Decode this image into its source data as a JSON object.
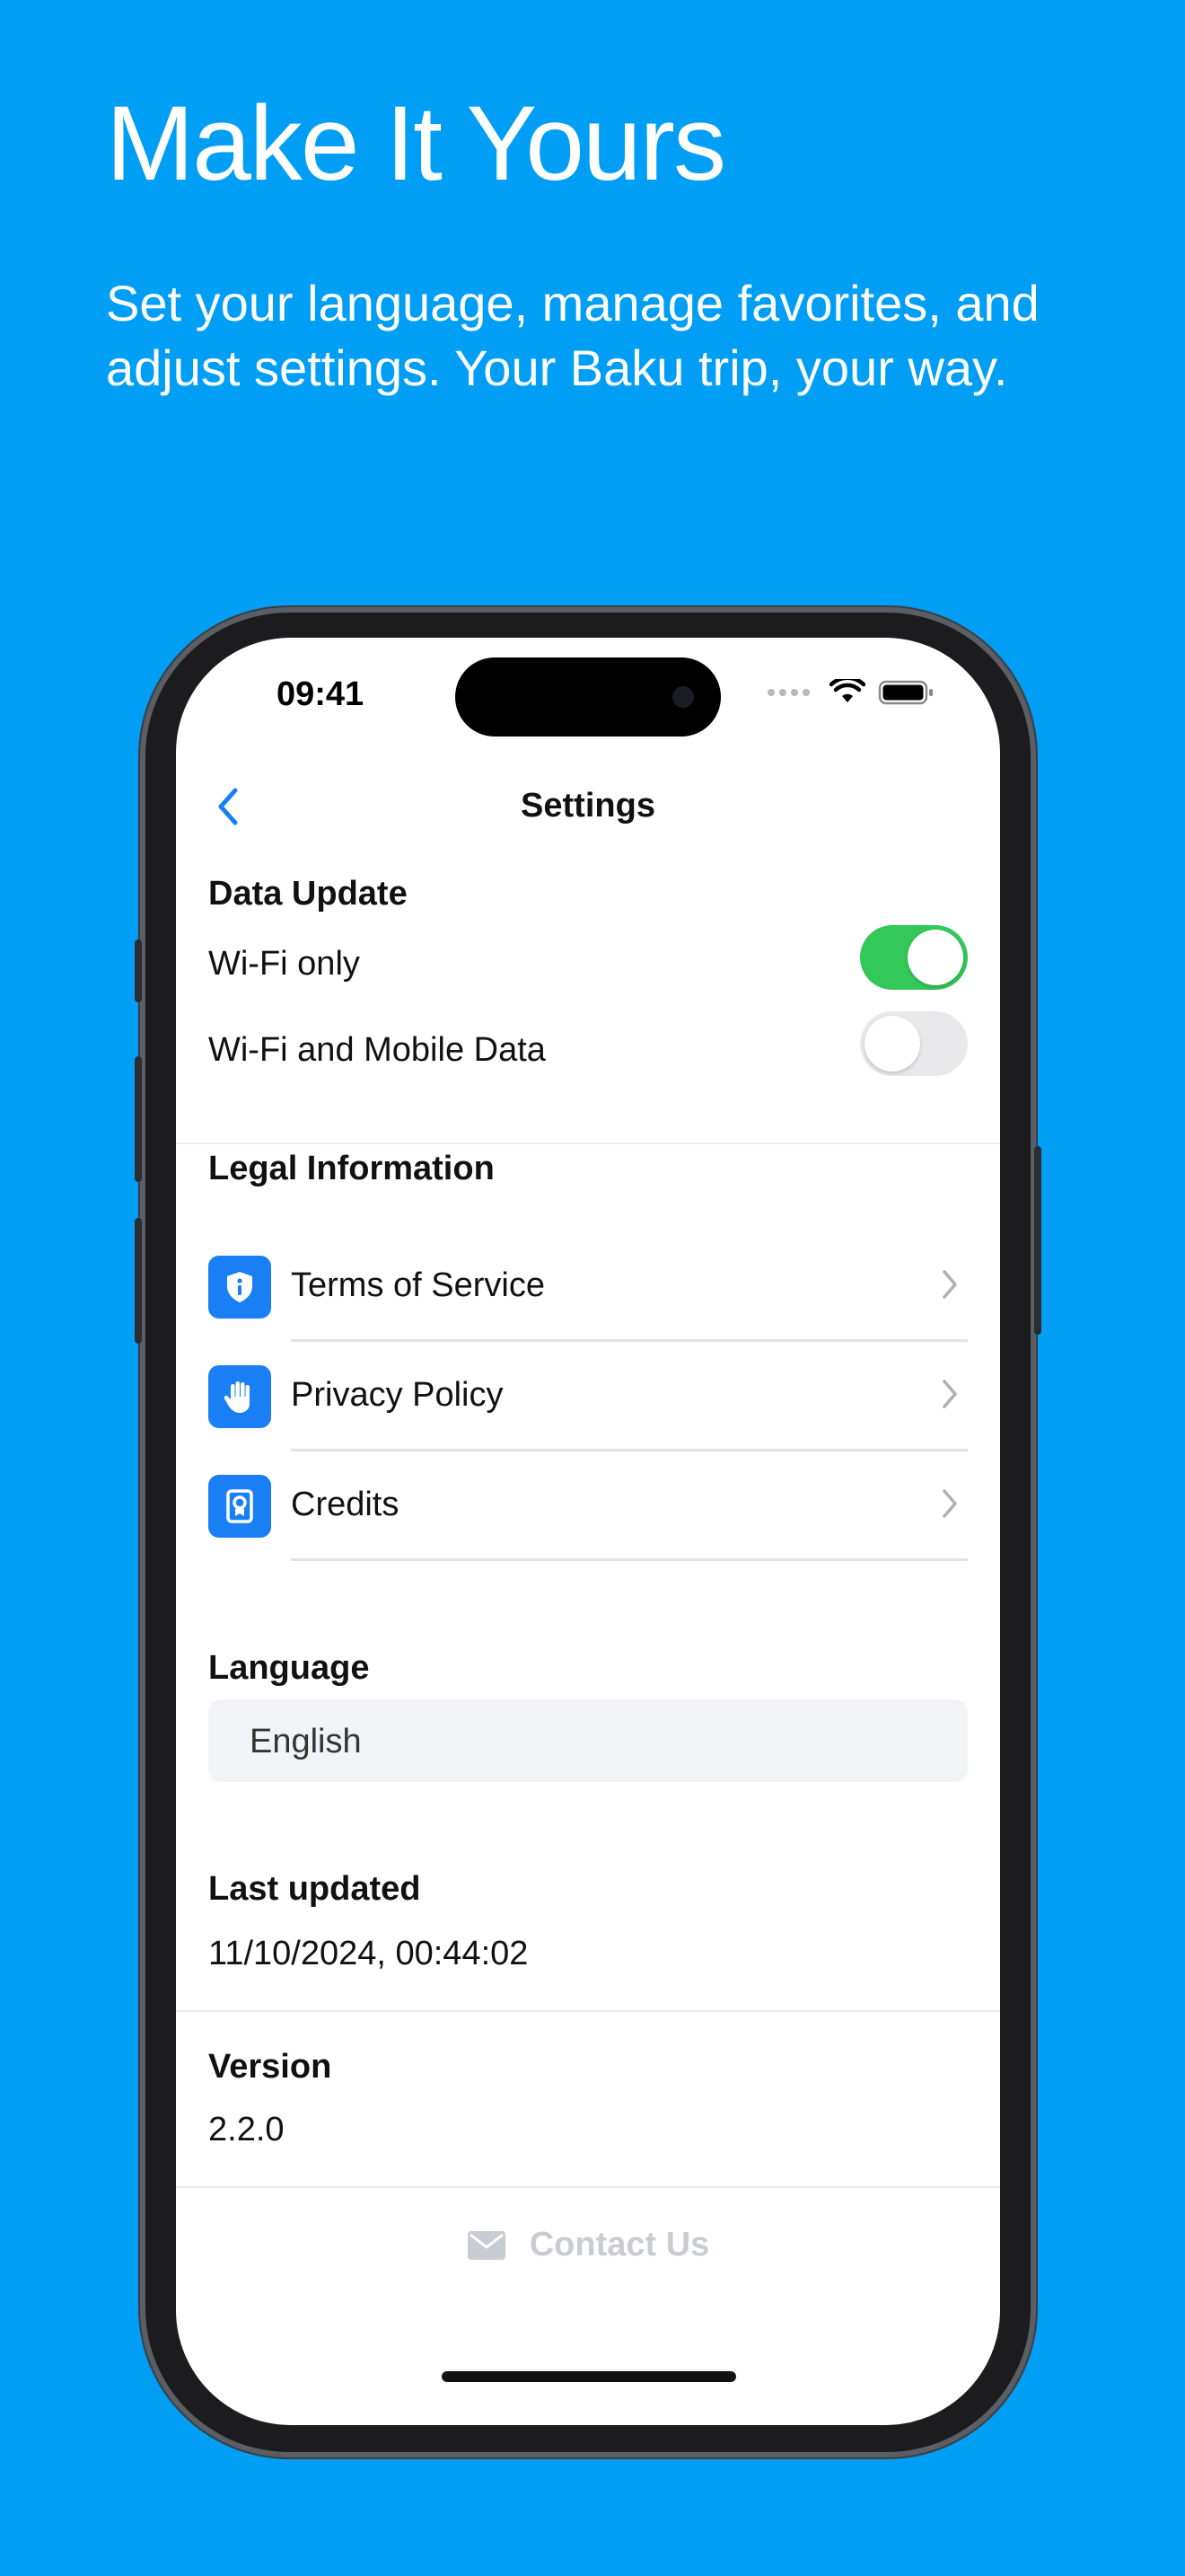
{
  "hero": {
    "title": "Make It Yours",
    "subtitle_line1": "Set your language, manage favorites, and",
    "subtitle_line2": "adjust settings. Your Baku trip, your way."
  },
  "status_bar": {
    "time": "09:41"
  },
  "nav": {
    "title": "Settings",
    "back_icon": "chevron-left-icon"
  },
  "data_update": {
    "title": "Data Update",
    "options": [
      {
        "label": "Wi-Fi only",
        "on": true
      },
      {
        "label": "Wi-Fi and Mobile Data",
        "on": false
      }
    ]
  },
  "legal": {
    "title": "Legal Information",
    "items": [
      {
        "label": "Terms of Service",
        "icon": "shield-info-icon"
      },
      {
        "label": "Privacy Policy",
        "icon": "hand-icon"
      },
      {
        "label": "Credits",
        "icon": "badge-icon"
      }
    ]
  },
  "language": {
    "title": "Language",
    "value": "English"
  },
  "last_updated": {
    "title": "Last updated",
    "value": "11/10/2024, 00:44:02"
  },
  "version": {
    "title": "Version",
    "value": "2.2.0"
  },
  "contact": {
    "label": "Contact Us",
    "icon": "mail-icon"
  },
  "colors": {
    "background": "#009EF5",
    "accent": "#1a7ff5",
    "toggle_on": "#34c759",
    "toggle_off": "#e9e9ec"
  }
}
